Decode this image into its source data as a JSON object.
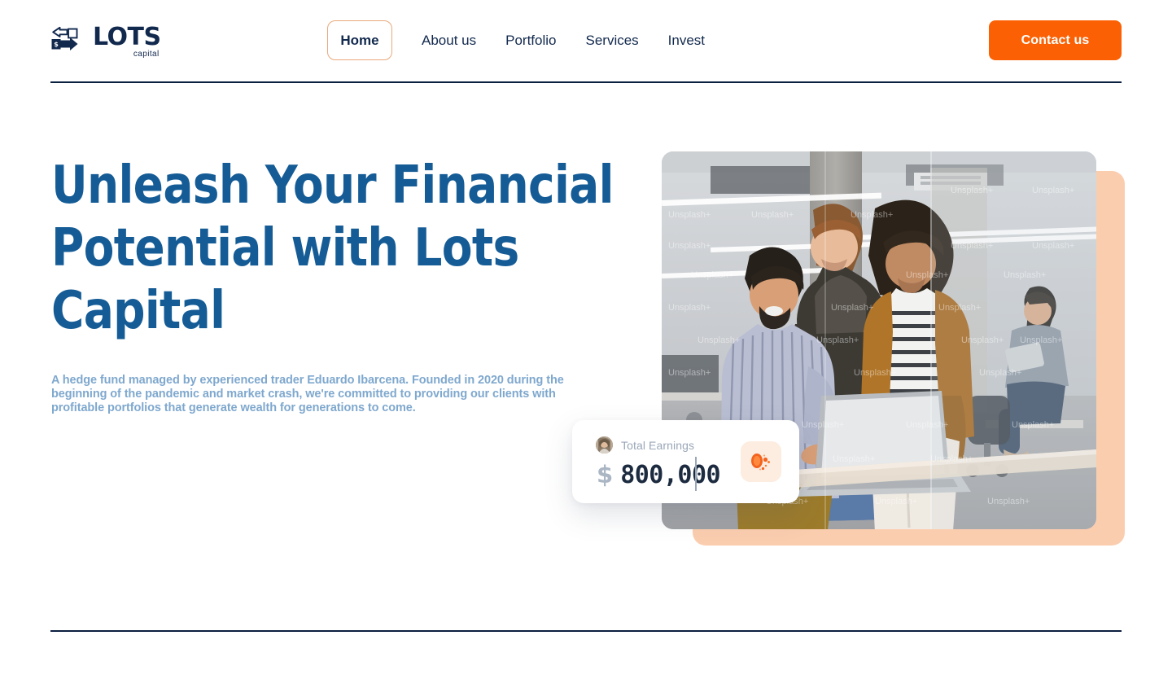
{
  "brand": {
    "name": "LOTS",
    "tagline": "capital",
    "logo_icon": "money-transfer-arrows-icon",
    "navy": "#12294E",
    "accent_orange": "#FB6104",
    "heading_blue": "#155C96",
    "body_blue": "#7FA8CE",
    "peach": "#FBCDAF"
  },
  "nav": {
    "items": [
      {
        "label": "Home",
        "active": true
      },
      {
        "label": "About us",
        "active": false
      },
      {
        "label": "Portfolio",
        "active": false
      },
      {
        "label": "Services",
        "active": false
      },
      {
        "label": "Invest",
        "active": false
      }
    ],
    "cta_label": "Contact us"
  },
  "hero": {
    "title_line_1": "Unleash Your Financial",
    "title_line_2": "Potential with Lots",
    "title_line_3": "Capital",
    "description": "A hedge fund managed by experienced trader Eduardo Ibarcena. Founded in 2020 during the beginning of the pandemic and market crash, we're committed to providing our clients with profitable portfolios that generate wealth for generations to come.",
    "photo_alt": "Three colleagues gathered around a laptop in a modern open-plan office",
    "photo_watermark": "Unsplash+"
  },
  "earnings_card": {
    "label": "Total Earnings",
    "currency_symbol": "$",
    "amount": "800,000",
    "avatar_icon": "user-avatar-photo",
    "badge_icon": "coin-sparkle-icon"
  }
}
